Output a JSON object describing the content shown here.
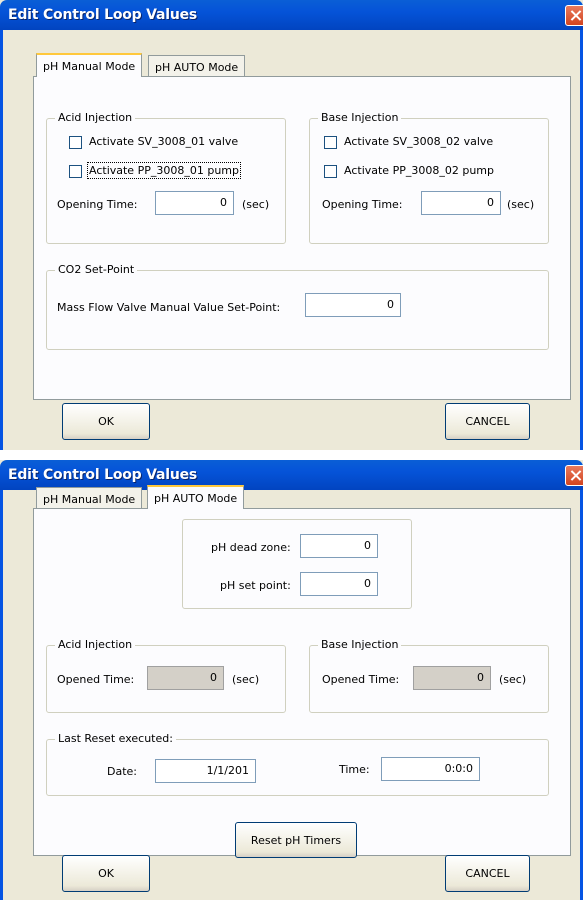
{
  "dialog1": {
    "title": "Edit Control Loop Values",
    "tabs": [
      "pH Manual Mode",
      "pH AUTO Mode"
    ],
    "acid": {
      "legend": "Acid Injection",
      "chk_valve": "Activate SV_3008_01 valve",
      "chk_pump": "Activate PP_3008_01 pump",
      "opening_label": "Opening Time:",
      "opening_value": "0",
      "unit": "(sec)"
    },
    "base": {
      "legend": "Base Injection",
      "chk_valve": "Activate SV_3008_02 valve",
      "chk_pump": "Activate PP_3008_02 pump",
      "opening_label": "Opening Time:",
      "opening_value": "0",
      "unit": "(sec)"
    },
    "co2": {
      "legend": "CO2 Set-Point",
      "label": "Mass Flow Valve Manual Value Set-Point:",
      "value": "0"
    },
    "ok": "OK",
    "cancel": "CANCEL"
  },
  "dialog2": {
    "title": "Edit Control Loop Values",
    "tabs": [
      "pH Manual Mode",
      "pH AUTO Mode"
    ],
    "dead_zone_label": "pH dead zone:",
    "dead_zone_value": "0",
    "set_point_label": "pH set point:",
    "set_point_value": "0",
    "acid": {
      "legend": "Acid Injection",
      "label": "Opened Time:",
      "value": "0",
      "unit": "(sec)"
    },
    "base": {
      "legend": "Base Injection",
      "label": "Opened Time:",
      "value": "0",
      "unit": "(sec)"
    },
    "reset": {
      "legend": "Last Reset executed:",
      "date_label": "Date:",
      "date_value": "1/1/201",
      "time_label": "Time:",
      "time_value": "0:0:0",
      "button": "Reset pH Timers"
    },
    "ok": "OK",
    "cancel": "CANCEL"
  }
}
